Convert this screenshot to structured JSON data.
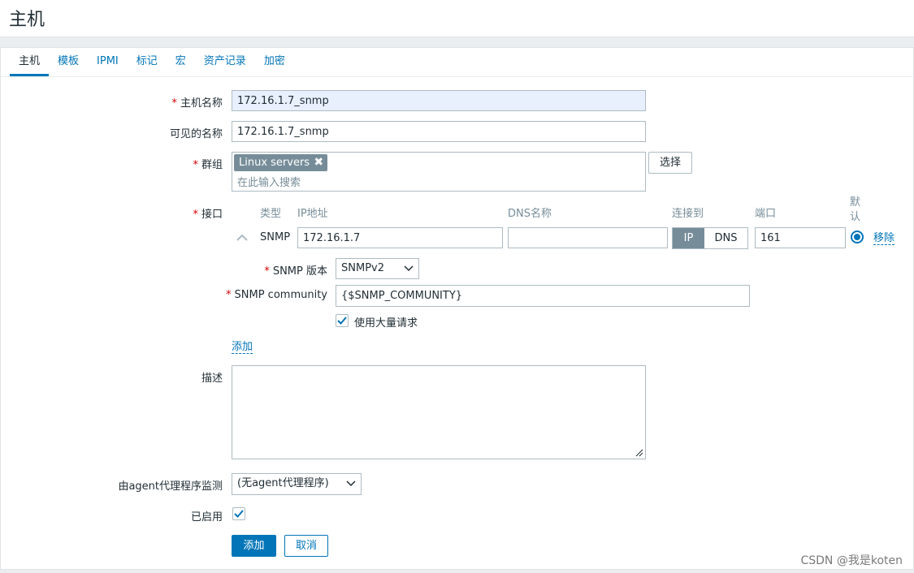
{
  "page": {
    "title": "主机"
  },
  "tabs": [
    {
      "label": "主机"
    },
    {
      "label": "模板"
    },
    {
      "label": "IPMI"
    },
    {
      "label": "标记"
    },
    {
      "label": "宏"
    },
    {
      "label": "资产记录"
    },
    {
      "label": "加密"
    }
  ],
  "form": {
    "host_name": {
      "label": "主机名称",
      "value": "172.16.1.7_snmp",
      "required_mark": "*"
    },
    "visible_name": {
      "label": "可见的名称",
      "value": "172.16.1.7_snmp"
    },
    "groups": {
      "label": "群组",
      "required_mark": "*",
      "tag": "Linux servers",
      "placeholder": "在此输入搜索",
      "select_button": "选择"
    },
    "interfaces": {
      "label": "接口",
      "required_mark": "*",
      "headers": {
        "type": "类型",
        "ip": "IP地址",
        "dns": "DNS名称",
        "connect": "连接到",
        "port": "端口",
        "default": "默认"
      },
      "row": {
        "type": "SNMP",
        "ip": "172.16.1.7",
        "dns": "",
        "ip_btn": "IP",
        "dns_btn": "DNS",
        "port": "161",
        "remove": "移除"
      },
      "snmp_version": {
        "label": "SNMP 版本",
        "value": "SNMPv2",
        "required_mark": "*"
      },
      "snmp_community": {
        "label": "SNMP community",
        "value": "{$SNMP_COMMUNITY}",
        "required_mark": "*"
      },
      "bulk": {
        "label": "使用大量请求",
        "checked": true
      },
      "add_link": "添加"
    },
    "description": {
      "label": "描述",
      "value": ""
    },
    "proxy": {
      "label": "由agent代理程序监测",
      "value": "(无agent代理程序)"
    },
    "enabled": {
      "label": "已启用",
      "checked": true
    },
    "buttons": {
      "add": "添加",
      "cancel": "取消"
    }
  },
  "watermark": "CSDN @我是koten",
  "colors": {
    "accent": "#0275b8",
    "required": "#d40000",
    "tag_bg": "#768d99",
    "toggle_active": "#768d99"
  }
}
